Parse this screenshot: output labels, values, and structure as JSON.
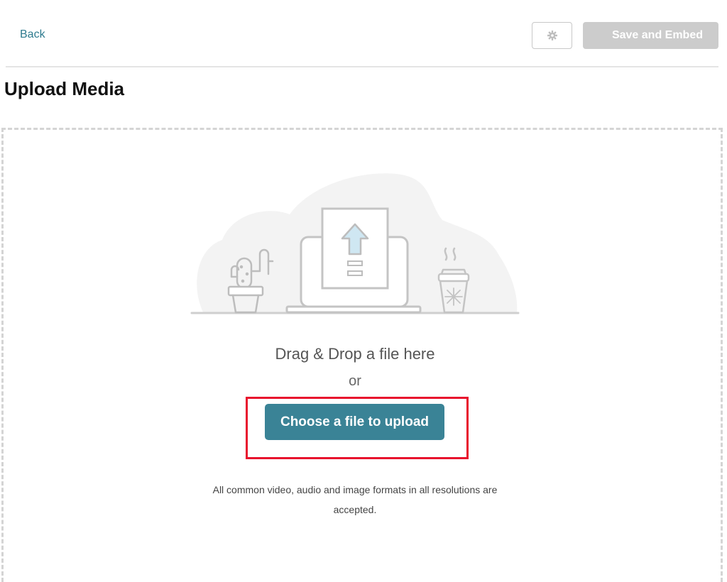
{
  "header": {
    "back_label": "Back",
    "settings_icon": "gear-icon",
    "save_label": "Save and Embed"
  },
  "page": {
    "title": "Upload Media"
  },
  "dropzone": {
    "drag_text": "Drag & Drop a file here",
    "or_text": "or",
    "choose_label": "Choose a file to upload",
    "formats_text": "All common video, audio and image formats in all resolutions are accepted.",
    "illustration": "upload-illustration"
  },
  "colors": {
    "accent": "#3a8396",
    "link": "#2d7a8e",
    "disabled_button": "#cccccc",
    "highlight": "#e8122d"
  }
}
